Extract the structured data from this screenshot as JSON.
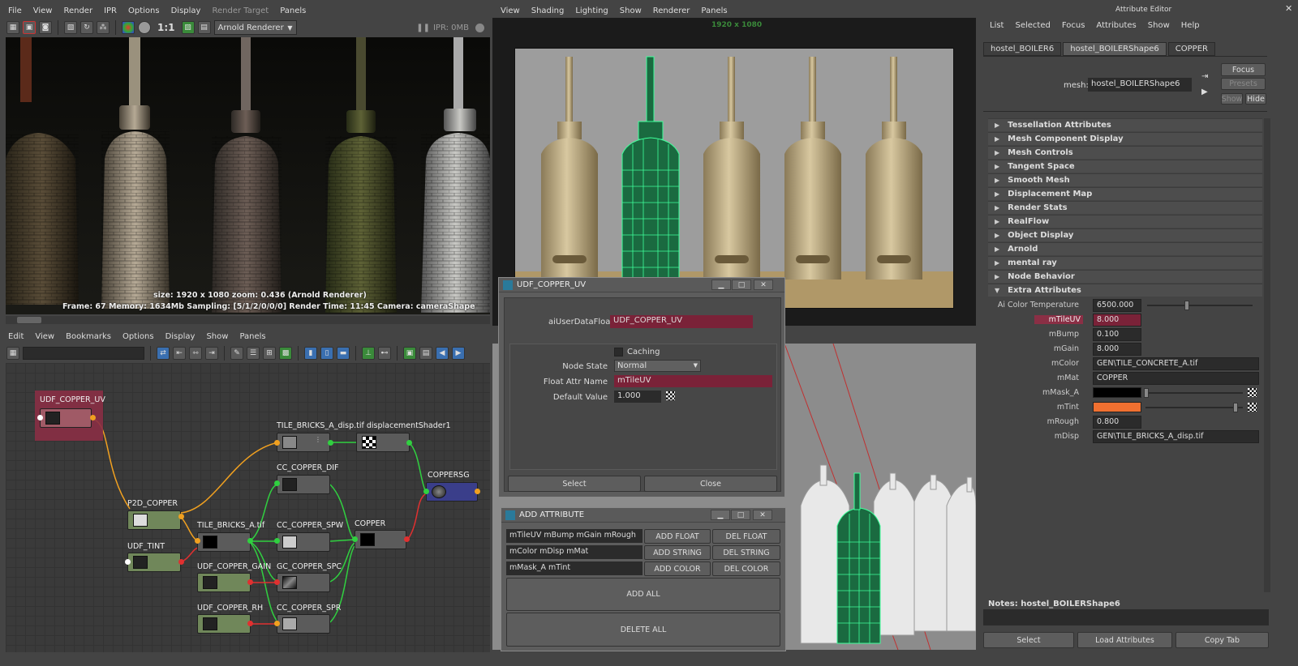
{
  "render_view": {
    "menu": [
      "File",
      "View",
      "Render",
      "IPR",
      "Options",
      "Display",
      "Render Target",
      "Panels"
    ],
    "renderer": "Arnold Renderer",
    "ratio_label": "1:1",
    "ipr_label": "IPR: 0MB",
    "hud_line1": "size: 1920 x 1080 zoom: 0.436     (Arnold Renderer)",
    "hud_line2": "Frame: 67    Memory: 1634Mb    Sampling: [5/1/2/0/0/0]    Render Time: 11:45    Camera: cameraShape"
  },
  "viewport": {
    "menu": [
      "View",
      "Shading",
      "Lighting",
      "Show",
      "Renderer",
      "Panels"
    ],
    "resolution": "1920 x 1080"
  },
  "node_editor": {
    "menu": [
      "Edit",
      "View",
      "Bookmarks",
      "Options",
      "Display",
      "Show",
      "Panels"
    ],
    "nodes": {
      "udf_copper_uv": "UDF_COPPER_UV",
      "tile_disp": "TILE_BRICKS_A_disp.tif displacementShader1",
      "cc_dif": "CC_COPPER_DIF",
      "coppersg": "COPPERSG",
      "p2d": "P2D_COPPER",
      "tile_bricks": "TILE_BRICKS_A.tif",
      "cc_spw": "CC_COPPER_SPW",
      "copper": "COPPER",
      "udf_tint": "UDF_TINT",
      "udf_gain": "UDF_COPPER_GAIN",
      "gc_spc": "GC_COPPER_SPC",
      "udf_rh": "UDF_COPPER_RH",
      "cc_spr": "CC_COPPER_SPR"
    }
  },
  "udf_dialog": {
    "title": "UDF_COPPER_UV",
    "ai_label": "aiUserDataFloat:",
    "ai_value": "UDF_COPPER_UV",
    "caching": "Caching",
    "node_state_label": "Node State",
    "node_state": "Normal",
    "float_attr_label": "Float Attr Name",
    "float_attr": "mTileUV",
    "default_label": "Default Value",
    "default_value": "1.000",
    "select": "Select",
    "close": "Close"
  },
  "add_attr": {
    "title": "ADD ATTRIBUTE",
    "float_list": "mTileUV mBump mGain mRough",
    "string_list": "mColor mDisp mMat",
    "color_list": "mMask_A mTint",
    "add_float": "ADD FLOAT",
    "del_float": "DEL FLOAT",
    "add_string": "ADD STRING",
    "del_string": "DEL STRING",
    "add_color": "ADD COLOR",
    "del_color": "DEL COLOR",
    "add_all": "ADD ALL",
    "delete_all": "DELETE ALL"
  },
  "attr_editor": {
    "title": "Attribute Editor",
    "menu": [
      "List",
      "Selected",
      "Focus",
      "Attributes",
      "Show",
      "Help"
    ],
    "tabs": [
      "hostel_BOILER6",
      "hostel_BOILERShape6",
      "COPPER"
    ],
    "mesh_label": "mesh:",
    "mesh_value": "hostel_BOILERShape6",
    "focus": "Focus",
    "presets": "Presets",
    "show": "Show",
    "hide": "Hide",
    "sections": [
      "Tessellation Attributes",
      "Mesh Component Display",
      "Mesh Controls",
      "Tangent Space",
      "Smooth Mesh",
      "Displacement Map",
      "Render Stats",
      "RealFlow",
      "Object Display",
      "Arnold",
      "mental ray",
      "Node Behavior",
      "Extra Attributes"
    ],
    "attrs": {
      "temp_label": "Ai Color Temperature",
      "temp": "6500.000",
      "tileuv_label": "mTileUV",
      "tileuv": "8.000",
      "bump_label": "mBump",
      "bump": "0.100",
      "gain_label": "mGain",
      "gain": "8.000",
      "color_label": "mColor",
      "color": "GEN\\TILE_CONCRETE_A.tif",
      "mat_label": "mMat",
      "mat": "COPPER",
      "mask_label": "mMask_A",
      "tint_label": "mTint",
      "rough_label": "mRough",
      "rough": "0.800",
      "disp_label": "mDisp",
      "disp": "GEN\\TILE_BRICKS_A_disp.tif"
    },
    "notes_label": "Notes:  hostel_BOILERShape6",
    "select": "Select",
    "load": "Load Attributes",
    "copy": "Copy Tab"
  },
  "colors": {
    "tint": "#f07030",
    "highlight": "#8a2f45",
    "wire": "#3fff9a"
  }
}
